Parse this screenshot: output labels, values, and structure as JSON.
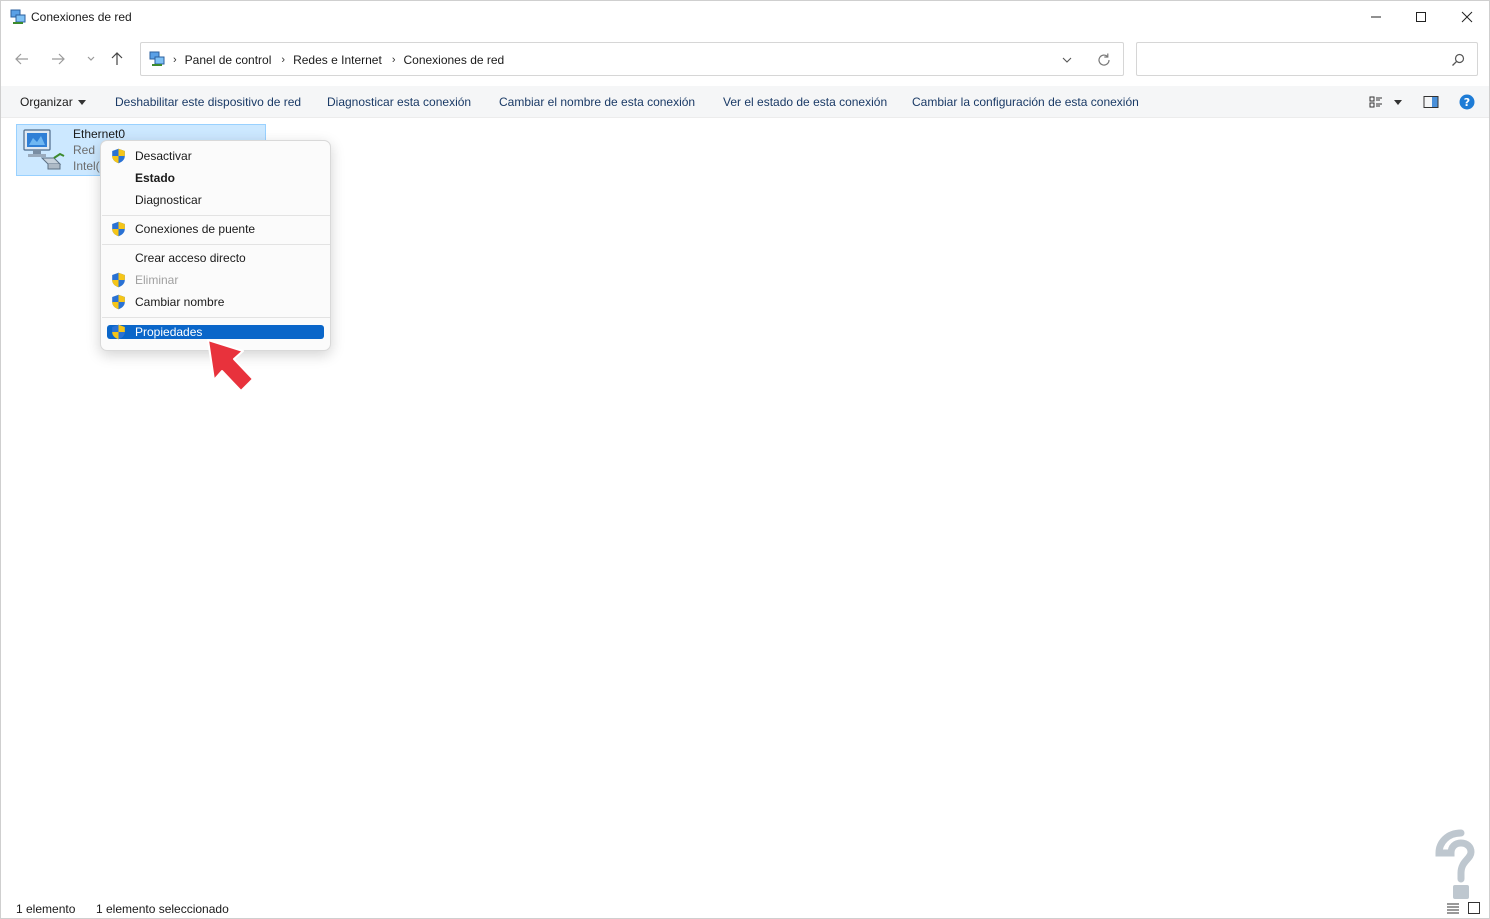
{
  "window": {
    "title": "Conexiones de red",
    "icons": {
      "app": "network-connections-icon",
      "minimize": "minimize-icon",
      "maximize": "maximize-icon",
      "close": "close-icon"
    }
  },
  "nav": {
    "icons": [
      "back-arrow-icon",
      "forward-arrow-icon",
      "recent-locations-chevron-icon",
      "up-arrow-icon"
    ]
  },
  "address": {
    "breadcrumbs": [
      "Panel de control",
      "Redes e Internet",
      "Conexiones de red"
    ],
    "separator": "›",
    "icons": {
      "location": "control-panel-icon",
      "history": "chevron-down-icon",
      "refresh": "refresh-icon"
    }
  },
  "search": {
    "value": "",
    "placeholder": "",
    "icon": "search-icon"
  },
  "commandbar": {
    "organize": "Organizar",
    "commands": [
      "Deshabilitar este dispositivo de red",
      "Diagnosticar esta conexión",
      "Cambiar el nombre de esta conexión",
      "Ver el estado de esta conexión",
      "Cambiar la configuración de esta conexión"
    ],
    "icons": {
      "layout": "change-view-icon",
      "layout_more": "dropdown-caret-icon",
      "preview": "preview-pane-icon",
      "help": "help-icon"
    }
  },
  "connection": {
    "name": "Ethernet0",
    "status": "Red",
    "adapter": "Intel(",
    "icon": "ethernet-adapter-icon",
    "selected": true
  },
  "context_menu": {
    "groups": [
      [
        {
          "label": "Desactivar",
          "shield": true,
          "bold": false,
          "disabled": false
        },
        {
          "label": "Estado",
          "shield": false,
          "bold": true,
          "disabled": false
        },
        {
          "label": "Diagnosticar",
          "shield": false,
          "bold": false,
          "disabled": false
        }
      ],
      [
        {
          "label": "Conexiones de puente",
          "shield": true,
          "bold": false,
          "disabled": false
        }
      ],
      [
        {
          "label": "Crear acceso directo",
          "shield": false,
          "bold": false,
          "disabled": false
        },
        {
          "label": "Eliminar",
          "shield": true,
          "bold": false,
          "disabled": true
        },
        {
          "label": "Cambiar nombre",
          "shield": true,
          "bold": false,
          "disabled": false
        }
      ],
      [
        {
          "label": "Propiedades",
          "shield": true,
          "bold": false,
          "disabled": false,
          "highlighted": true
        }
      ]
    ],
    "icons": {
      "shield": "uac-shield-icon",
      "pointer": "red-arrow-pointer-icon"
    }
  },
  "statusbar": {
    "item_count": "1 elemento",
    "selection": "1 elemento seleccionado",
    "icons": {
      "details": "details-view-icon",
      "tiles": "large-icons-view-icon"
    }
  },
  "colors": {
    "selection_bg": "#cce8ff",
    "selection_border": "#99d1ff",
    "menu_highlight": "#0a66c9",
    "command_text": "#1a3a66",
    "arrow": "#e8323c",
    "help": "#1e7cd6"
  },
  "watermark": {
    "icon": "watermark-logo-icon"
  }
}
